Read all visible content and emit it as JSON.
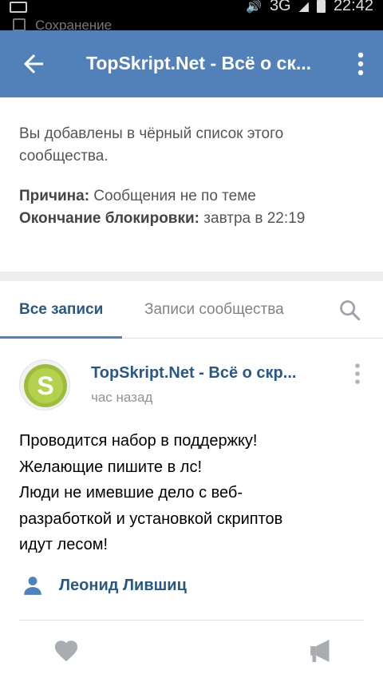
{
  "statusbar": {
    "ghost_text": "Сохранение",
    "network": "3G",
    "time": "22:42"
  },
  "appbar": {
    "title": "TopSkript.Net - Всё о ск...",
    "back_icon": "arrow-left-icon",
    "more_icon": "more-vertical-icon",
    "color": "#5181b8"
  },
  "banner": {
    "message": "Вы добавлены в чёрный список этого сообщества.",
    "reason_label": "Причина:",
    "reason_value": " Сообщения не по теме",
    "end_label": "Окончание блокировки:",
    "end_value": " завтра в 22:19"
  },
  "tabs": {
    "items": [
      {
        "label": "Все записи",
        "active": true
      },
      {
        "label": "Записи сообщества",
        "active": false
      }
    ],
    "search_icon": "search-icon"
  },
  "post": {
    "author_name": "TopSkript.Net - Всё о скр...",
    "time": "час назад",
    "avatar_letter": "S",
    "lines": [
      "Проводится набор в поддержку!",
      "Желающие пишите в лс!",
      "Люди не имевшие дело с веб-",
      "разработкой и установкой скриптов",
      "идут лесом!"
    ],
    "signer": "Леонид Лившиц",
    "like_icon": "heart-icon",
    "share_icon": "megaphone-icon"
  }
}
